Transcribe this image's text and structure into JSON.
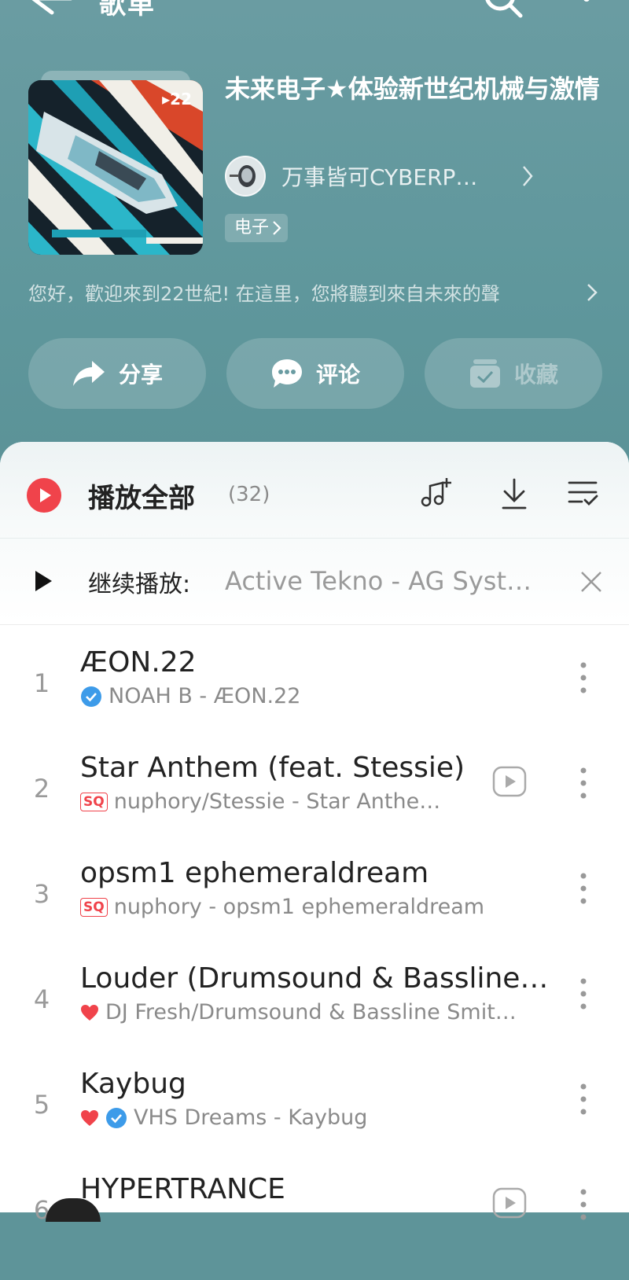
{
  "topbar": {
    "title": "歌单"
  },
  "playlist": {
    "title": "未来电子★体验新世纪机械与激情",
    "cover_count": "22",
    "creator": "万事皆可CYBERP…",
    "tag": "电子",
    "description": "您好，歡迎來到22世紀! 在這里，您將聽到來自未來的聲"
  },
  "actions": {
    "share": "分享",
    "comment": "评论",
    "collect": "收藏"
  },
  "list_header": {
    "play_all": "播放全部",
    "count": "(32)"
  },
  "resume": {
    "label": "继续播放:",
    "track": "Active Tekno - AG Syst…"
  },
  "songs": [
    {
      "index": "1",
      "title": "ÆON.22",
      "subtitle": "NOAH B - ÆON.22"
    },
    {
      "index": "2",
      "title": "Star Anthem (feat. Stessie)",
      "subtitle": "nuphory/Stessie - Star Anthe…",
      "badge": "SQ"
    },
    {
      "index": "3",
      "title": "opsm1 ephemeraldream",
      "subtitle": "nuphory - opsm1 ephemeraldream",
      "badge": "SQ"
    },
    {
      "index": "4",
      "title": "Louder (Drumsound & Bassline…",
      "subtitle": "DJ Fresh/Drumsound & Bassline Smit…"
    },
    {
      "index": "5",
      "title": "Kaybug",
      "subtitle": "VHS Dreams - Kaybug"
    },
    {
      "index": "6",
      "title": "HYPERTRANCE"
    }
  ],
  "colors": {
    "accent_red": "#f0434b",
    "header_teal": "#5f979c",
    "verified_blue": "#3d9be9"
  }
}
